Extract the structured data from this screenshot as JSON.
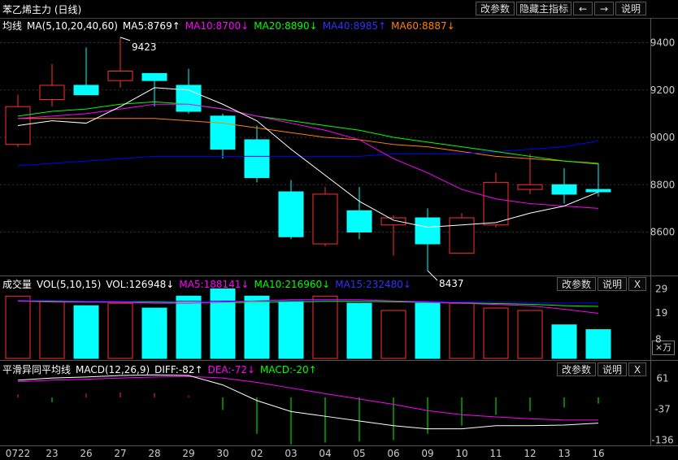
{
  "header": {
    "title": "苯乙烯主力 (日线)",
    "buttons": [
      "改参数",
      "隐藏主指标",
      "←",
      "→",
      "说明"
    ]
  },
  "main_legend": {
    "name": "均线",
    "params": "MA(5,10,20,40,60)",
    "ma5": "MA5:8769↑",
    "ma10": "MA10:8700↓",
    "ma20": "MA20:8890↓",
    "ma40": "MA40:8985↑",
    "ma60": "MA60:8887↓"
  },
  "vol_legend": {
    "name": "成交量",
    "params": "VOL(5,10,15)",
    "vol": "VOL:126948↓",
    "ma5": "MA5:188141↓",
    "ma10": "MA10:216960↓",
    "ma15": "MA15:232480↓",
    "buttons": [
      "改参数",
      "说明",
      "X"
    ],
    "unit": "×万"
  },
  "macd_legend": {
    "name": "平滑异同平均线",
    "params": "MACD(12,26,9)",
    "diff": "DIFF:-82↑",
    "dea": "DEA:-72↓",
    "macd": "MACD:-20↑",
    "buttons": [
      "改参数",
      "说明",
      "X"
    ]
  },
  "colors": {
    "up": "#ff3030",
    "down": "#00ffff",
    "ma5": "#ffffff",
    "ma10": "#ff00ff",
    "ma20": "#00ff00",
    "ma40": "#0000ff",
    "ma60": "#ff8000"
  },
  "chart_data": [
    {
      "type": "candlestick",
      "x": [
        "0722",
        "23",
        "26",
        "27",
        "28",
        "29",
        "30",
        "02",
        "03",
        "04",
        "05",
        "06",
        "09",
        "10",
        "11",
        "12",
        "13",
        "16"
      ],
      "ohlc": [
        [
          8970,
          9180,
          8960,
          9130
        ],
        [
          9160,
          9310,
          9130,
          9220
        ],
        [
          9220,
          9380,
          9190,
          9180
        ],
        [
          9240,
          9423,
          9210,
          9280
        ],
        [
          9270,
          9260,
          9130,
          9240
        ],
        [
          9220,
          9290,
          9100,
          9110
        ],
        [
          9090,
          9100,
          8910,
          8950
        ],
        [
          8990,
          9050,
          8810,
          8830
        ],
        [
          8770,
          8820,
          8570,
          8580
        ],
        [
          8550,
          8790,
          8540,
          8760
        ],
        [
          8690,
          8790,
          8570,
          8600
        ],
        [
          8630,
          8670,
          8500,
          8660
        ],
        [
          8660,
          8700,
          8437,
          8550
        ],
        [
          8510,
          8680,
          8510,
          8660
        ],
        [
          8630,
          8850,
          8620,
          8810
        ],
        [
          8780,
          8930,
          8760,
          8800
        ],
        [
          8800,
          8870,
          8720,
          8760
        ],
        [
          8780,
          8890,
          8750,
          8770
        ]
      ],
      "ma5": [
        9050,
        9070,
        9060,
        9130,
        9210,
        9200,
        9140,
        9070,
        8950,
        8840,
        8730,
        8650,
        8620,
        8630,
        8640,
        8680,
        8710,
        8769
      ],
      "ma10": [
        9080,
        9090,
        9100,
        9120,
        9140,
        9140,
        9120,
        9090,
        9060,
        9030,
        8990,
        8910,
        8850,
        8780,
        8740,
        8720,
        8710,
        8700
      ],
      "ma20": [
        9090,
        9110,
        9120,
        9140,
        9150,
        9140,
        9120,
        9090,
        9070,
        9050,
        9030,
        9000,
        8980,
        8960,
        8940,
        8920,
        8900,
        8890
      ],
      "ma40": [
        8880,
        8890,
        8900,
        8910,
        8920,
        8920,
        8920,
        8920,
        8920,
        8920,
        8920,
        8930,
        8930,
        8930,
        8940,
        8950,
        8960,
        8985
      ],
      "ma60": [
        9080,
        9080,
        9080,
        9080,
        9080,
        9070,
        9060,
        9040,
        9020,
        9000,
        8990,
        8970,
        8960,
        8940,
        8920,
        8910,
        8900,
        8887
      ],
      "y_ticks": [
        8600,
        8800,
        9000,
        9200,
        9400
      ],
      "ylim": [
        8430,
        9450
      ],
      "annotations": [
        {
          "label": "9423",
          "x": "27"
        },
        {
          "label": "8437",
          "x": "09"
        }
      ]
    },
    {
      "type": "bar",
      "title": "成交量",
      "x": [
        "0722",
        "23",
        "26",
        "27",
        "28",
        "29",
        "30",
        "02",
        "03",
        "04",
        "05",
        "06",
        "09",
        "10",
        "11",
        "12",
        "13",
        "16"
      ],
      "values": [
        26,
        24,
        22,
        23,
        21,
        26,
        29,
        26,
        24,
        26,
        23,
        20,
        23,
        23,
        21,
        20,
        14,
        12
      ],
      "direction": [
        "up",
        "up",
        "down",
        "up",
        "down",
        "down",
        "down",
        "down",
        "down",
        "up",
        "down",
        "up",
        "down",
        "up",
        "up",
        "up",
        "down",
        "down"
      ],
      "ma5": [
        24,
        23.5,
        23.5,
        23.5,
        23,
        23,
        23.5,
        24,
        24.5,
        24.5,
        24.5,
        24,
        23.5,
        23,
        22.5,
        22,
        20.5,
        18.8
      ],
      "ma10": [
        24,
        23.8,
        23.6,
        23.5,
        23.5,
        23.3,
        23.3,
        23.4,
        23.6,
        23.8,
        23.8,
        23.6,
        23.4,
        23.2,
        22.9,
        22.6,
        22,
        21.7
      ],
      "ma15": [
        24.2,
        24.1,
        24,
        24,
        23.9,
        23.9,
        23.9,
        23.9,
        24,
        24,
        24,
        23.9,
        23.8,
        23.6,
        23.5,
        23.3,
        23.1,
        23.2
      ],
      "y_ticks": [
        8,
        19,
        29
      ],
      "ylim": [
        0,
        29.5
      ]
    },
    {
      "type": "line",
      "title": "平滑异同平均线",
      "x": [
        "0722",
        "23",
        "26",
        "27",
        "28",
        "29",
        "30",
        "02",
        "03",
        "04",
        "05",
        "06",
        "09",
        "10",
        "11",
        "12",
        "13",
        "16"
      ],
      "diff": [
        55,
        62,
        65,
        70,
        72,
        70,
        40,
        -10,
        -45,
        -60,
        -75,
        -90,
        -100,
        -100,
        -90,
        -90,
        -88,
        -82
      ],
      "dea": [
        50,
        55,
        58,
        62,
        65,
        67,
        62,
        48,
        30,
        12,
        -5,
        -22,
        -42,
        -55,
        -62,
        -68,
        -72,
        -72
      ],
      "macd": [
        10,
        -15,
        12,
        16,
        14,
        6,
        -40,
        -116,
        -150,
        -144,
        -140,
        -136,
        -116,
        -90,
        -56,
        -44,
        -32,
        -20
      ],
      "y_ticks": [
        -136,
        -37,
        61
      ],
      "ylim": [
        -145,
        70
      ]
    }
  ]
}
